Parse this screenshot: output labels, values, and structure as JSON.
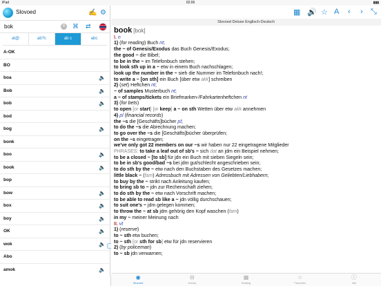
{
  "status": {
    "device": "iPad",
    "time": "02:06",
    "battery": "▮▮▮"
  },
  "app": {
    "name": "Slovoed"
  },
  "search": {
    "value": "bok"
  },
  "modes": [
    "at@",
    "ab?c",
    "ab c",
    "abc"
  ],
  "words": [
    {
      "text": "A-OK",
      "audio": false
    },
    {
      "text": "BO",
      "audio": false
    },
    {
      "text": "boa",
      "audio": true
    },
    {
      "text": "Bob",
      "audio": true
    },
    {
      "text": "bob",
      "audio": true
    },
    {
      "text": "bod",
      "audio": false
    },
    {
      "text": "bog",
      "audio": true
    },
    {
      "text": "bonk",
      "audio": false
    },
    {
      "text": "boo",
      "audio": true
    },
    {
      "text": "book",
      "audio": true
    },
    {
      "text": "bop",
      "audio": false
    },
    {
      "text": "bow",
      "audio": true
    },
    {
      "text": "box",
      "audio": true
    },
    {
      "text": "boy",
      "audio": true
    },
    {
      "text": "OK",
      "audio": true
    },
    {
      "text": "wok",
      "audio": true
    },
    {
      "text": "Abo",
      "audio": false
    },
    {
      "text": "amok",
      "audio": true
    }
  ],
  "dictionary_title": "Slovoed Deluxe Englisch-Deutsch",
  "entry": {
    "headword": "book",
    "transcription": "[bok]"
  },
  "tabs": [
    {
      "label": "Slovoed",
      "icon": "◉"
    },
    {
      "label": "Zurück",
      "icon": "⊟"
    },
    {
      "label": "Katalog",
      "icon": "▦"
    },
    {
      "label": "Favoriten",
      "icon": "☆"
    },
    {
      "label": "Info",
      "icon": "ⓘ"
    }
  ],
  "colors": {
    "accent": "#1e88d0",
    "roman": "#c0392b",
    "grammar": "#2a3fb0"
  }
}
